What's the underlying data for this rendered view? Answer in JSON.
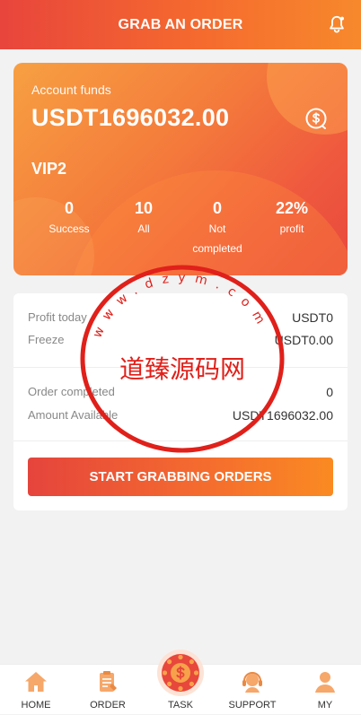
{
  "header": {
    "title": "GRAB AN ORDER",
    "bell_icon": "bell-icon"
  },
  "account": {
    "funds_label": "Account funds",
    "funds_value": "USDT1696032.00",
    "vip": "VIP2",
    "stats": [
      {
        "num": "0",
        "label": "Success"
      },
      {
        "num": "10",
        "label": "All"
      },
      {
        "num": "0",
        "label": "Not completed"
      },
      {
        "num": "22%",
        "label": "profit"
      }
    ]
  },
  "details": {
    "profit_today_label": "Profit today",
    "profit_today_value": "USDT0",
    "freeze_label": "Freeze",
    "freeze_value": "USDT0.00",
    "order_completed_label": "Order completed",
    "order_completed_value": "0",
    "amount_available_label": "Amount Available",
    "amount_available_value": "USDT1696032.00"
  },
  "grab_button": "START GRABBING ORDERS",
  "watermark": {
    "title": "道臻源码网",
    "ring_text": "www.dzym.com"
  },
  "tabs": [
    {
      "label": "HOME",
      "icon": "home-icon"
    },
    {
      "label": "ORDER",
      "icon": "order-icon"
    },
    {
      "label": "TASK",
      "icon": "task-icon"
    },
    {
      "label": "SUPPORT",
      "icon": "support-icon"
    },
    {
      "label": "MY",
      "icon": "user-icon"
    }
  ],
  "colors": {
    "accent": "#f46a2e",
    "accent_dark": "#e5443c",
    "stamp": "#e0201a",
    "tab_icon": "#f6a76a"
  }
}
